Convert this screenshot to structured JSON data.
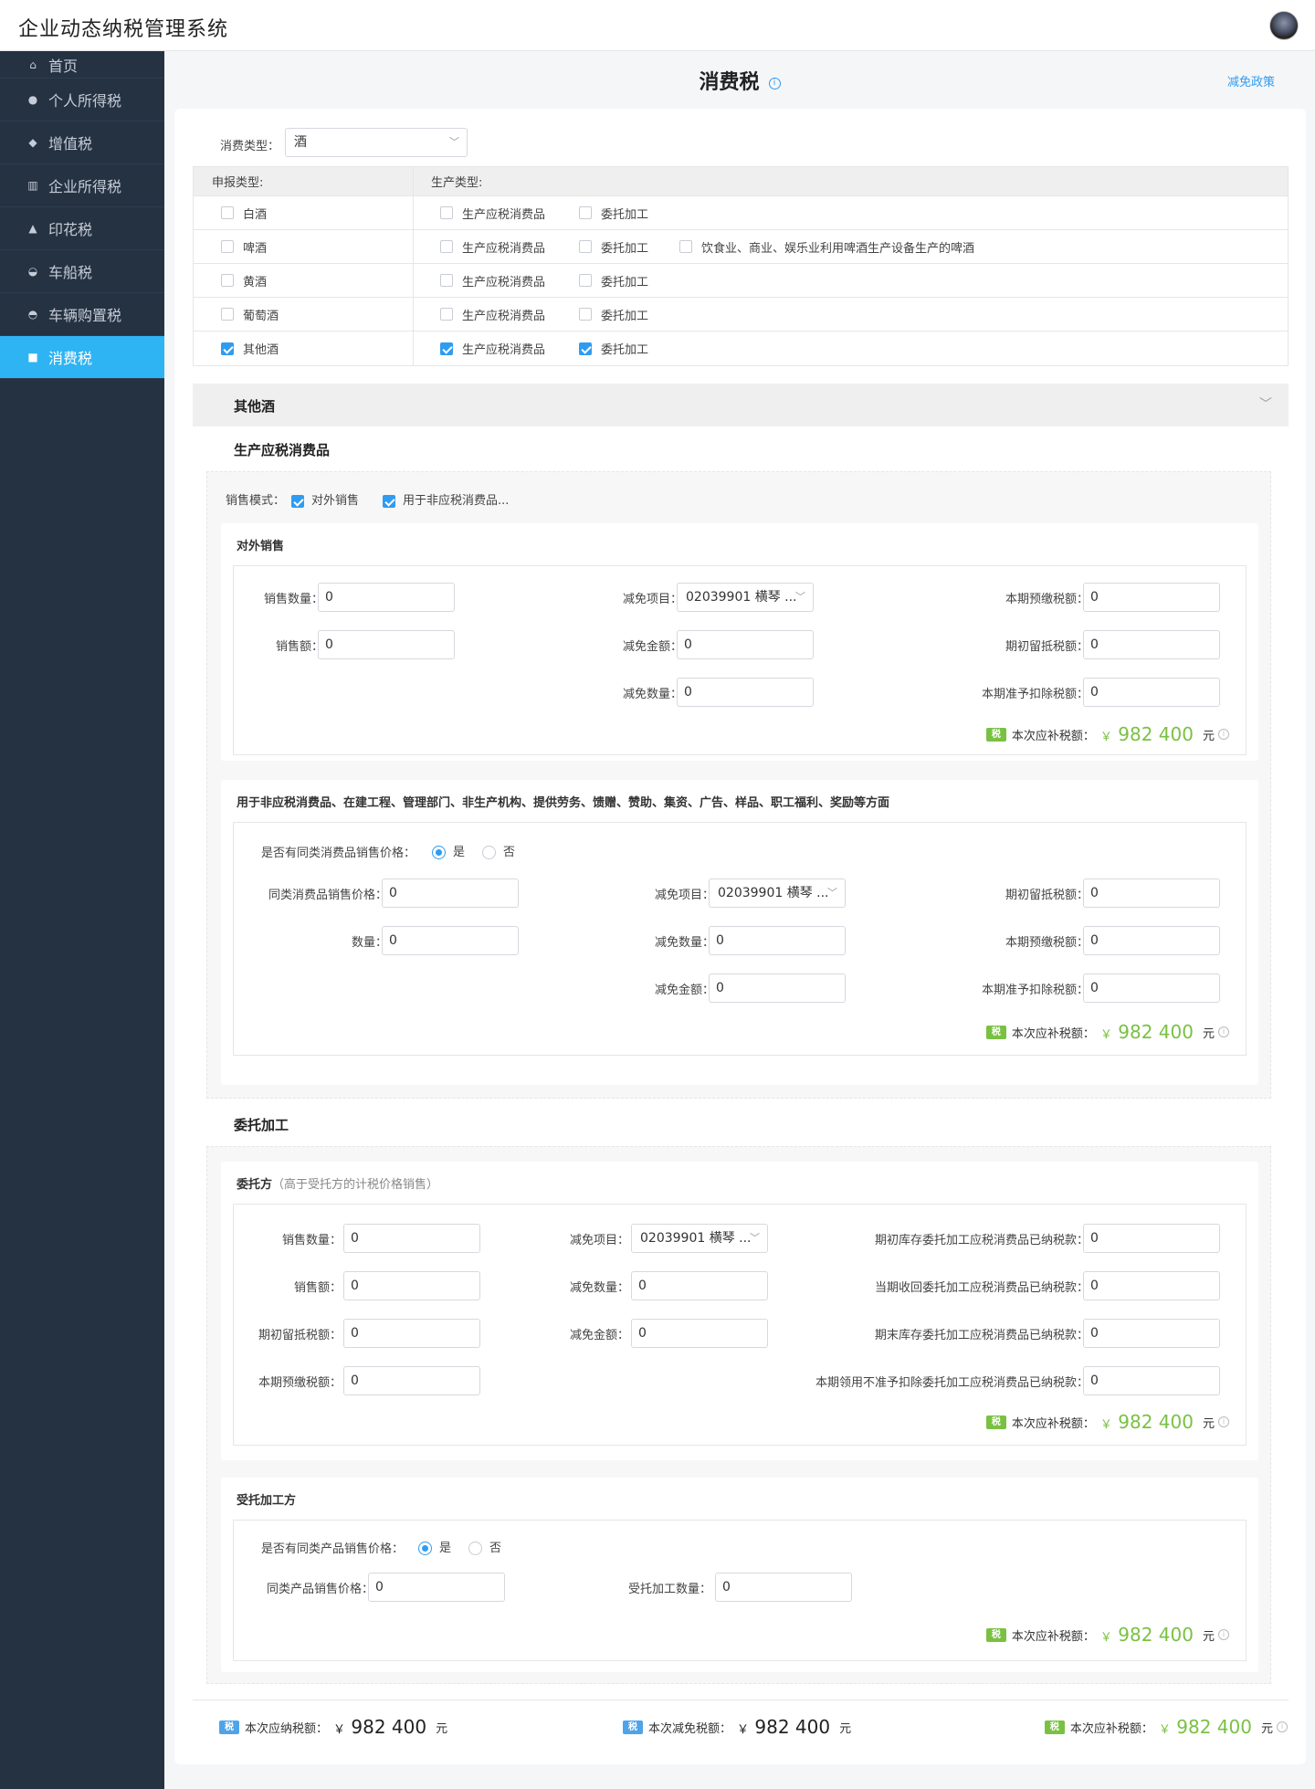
{
  "app": {
    "title": "企业动态纳税管理系统"
  },
  "sidebar": {
    "items": [
      {
        "label": "首页",
        "icon": "home-icon",
        "glyph": "⌂"
      },
      {
        "label": "个人所得税",
        "icon": "user-icon",
        "glyph": "●"
      },
      {
        "label": "增值税",
        "icon": "diamond-icon",
        "glyph": "◆"
      },
      {
        "label": "企业所得税",
        "icon": "building-icon",
        "glyph": "▥"
      },
      {
        "label": "印花税",
        "icon": "stamp-icon",
        "glyph": "▲"
      },
      {
        "label": "车船税",
        "icon": "ship-icon",
        "glyph": "◒"
      },
      {
        "label": "车辆购置税",
        "icon": "car-icon",
        "glyph": "◓"
      },
      {
        "label": "消费税",
        "icon": "bag-icon",
        "glyph": "■"
      }
    ],
    "active_index": 7
  },
  "page": {
    "title": "消费税",
    "info_glyph": "i",
    "policy_link": "减免政策"
  },
  "filter": {
    "label": "消费类型：",
    "value": "酒"
  },
  "table": {
    "header_declare": "申报类型:",
    "header_production": "生产类型:",
    "rows": [
      {
        "name": "白酒",
        "checked": false,
        "options": [
          {
            "label": "生产应税消费品",
            "checked": false
          },
          {
            "label": "委托加工",
            "checked": false
          }
        ]
      },
      {
        "name": "啤酒",
        "checked": false,
        "options": [
          {
            "label": "生产应税消费品",
            "checked": false
          },
          {
            "label": "委托加工",
            "checked": false
          },
          {
            "label": "饮食业、商业、娱乐业利用啤酒生产设备生产的啤酒",
            "checked": false
          }
        ]
      },
      {
        "name": "黄酒",
        "checked": false,
        "options": [
          {
            "label": "生产应税消费品",
            "checked": false
          },
          {
            "label": "委托加工",
            "checked": false
          }
        ]
      },
      {
        "name": "葡萄酒",
        "checked": false,
        "options": [
          {
            "label": "生产应税消费品",
            "checked": false
          },
          {
            "label": "委托加工",
            "checked": false
          }
        ]
      },
      {
        "name": "其他酒",
        "checked": true,
        "options": [
          {
            "label": "生产应税消费品",
            "checked": true
          },
          {
            "label": "委托加工",
            "checked": true
          }
        ]
      }
    ]
  },
  "section": {
    "title": "其他酒"
  },
  "production": {
    "title": "生产应税消费品",
    "mode_label": "销售模式：",
    "mode_options": [
      {
        "label": "对外销售",
        "checked": true
      },
      {
        "label": "用于非应税消费品...",
        "checked": true
      }
    ],
    "external": {
      "title": "对外销售",
      "sales_qty_label": "销售数量：",
      "sales_qty": "0",
      "sales_amt_label": "销售额：",
      "sales_amt": "0",
      "relief_item_label": "减免项目：",
      "relief_item": "02039901 横琴 ...",
      "relief_amt_label": "减免金额：",
      "relief_amt": "0",
      "relief_qty_label": "减免数量：",
      "relief_qty": "0",
      "prepaid_label": "本期预缴税额：",
      "prepaid": "0",
      "opening_label": "期初留抵税额：",
      "opening": "0",
      "deduct_label": "本期准予扣除税额：",
      "deduct": "0",
      "total_label": "本次应补税额：",
      "total_amount": "982 400"
    },
    "nontaxable": {
      "title": "用于非应税消费品、在建工程、管理部门、非生产机构、提供劳务、馈赠、赞助、集资、广告、样品、职工福利、奖励等方面",
      "question": "是否有同类消费品销售价格：",
      "yes": "是",
      "no": "否",
      "selected": "是",
      "price_label": "同类消费品销售价格：",
      "price": "0",
      "qty_label": "数量：",
      "qty": "0",
      "relief_item_label": "减免项目：",
      "relief_item": "02039901 横琴 ...",
      "relief_qty_label": "减免数量：",
      "relief_qty": "0",
      "relief_amt_label": "减免金额：",
      "relief_amt": "0",
      "opening_label": "期初留抵税额：",
      "opening": "0",
      "prepaid_label": "本期预缴税额：",
      "prepaid": "0",
      "deduct_label": "本期准予扣除税额：",
      "deduct": "0",
      "total_label": "本次应补税额：",
      "total_amount": "982 400"
    }
  },
  "commission": {
    "title": "委托加工",
    "client": {
      "title": "委托方",
      "hint": "（高于受托方的计税价格销售）",
      "sales_qty_label": "销售数量：",
      "sales_qty": "0",
      "sales_amt_label": "销售额：",
      "sales_amt": "0",
      "opening_label": "期初留抵税额：",
      "opening": "0",
      "prepaid_label": "本期预缴税额：",
      "prepaid": "0",
      "relief_item_label": "减免项目：",
      "relief_item": "02039901 横琴 ...",
      "relief_qty_label": "减免数量：",
      "relief_qty": "0",
      "relief_amt_label": "减免金额：",
      "relief_amt": "0",
      "begin_stock_label": "期初库存委托加工应税消费品已纳税款：",
      "begin_stock": "0",
      "recovered_label": "当期收回委托加工应税消费品已纳税款：",
      "recovered": "0",
      "end_stock_label": "期末库存委托加工应税消费品已纳税款：",
      "end_stock": "0",
      "nondeduct_label": "本期领用不准予扣除委托加工应税消费品已纳税款：",
      "nondeduct": "0",
      "total_label": "本次应补税额：",
      "total_amount": "982 400"
    },
    "processor": {
      "title": "受托加工方",
      "question": "是否有同类产品销售价格：",
      "yes": "是",
      "no": "否",
      "selected": "是",
      "price_label": "同类产品销售价格：",
      "price": "0",
      "qty_label": "受托加工数量：",
      "qty": "0",
      "total_label": "本次应补税额：",
      "total_amount": "982 400"
    }
  },
  "summary": {
    "payable_label": "本次应纳税额：",
    "payable": "982 400",
    "relief_label": "本次减免税额：",
    "relief": "982 400",
    "supplement_label": "本次应补税额：",
    "supplement": "982 400",
    "currency_symbol": "￥",
    "unit": "元",
    "badge_text": "税"
  },
  "colors": {
    "sidebar_bg": "#253242",
    "active": "#2fb4f3",
    "accent": "#2f9cf1",
    "amount_green": "#7ac143"
  }
}
